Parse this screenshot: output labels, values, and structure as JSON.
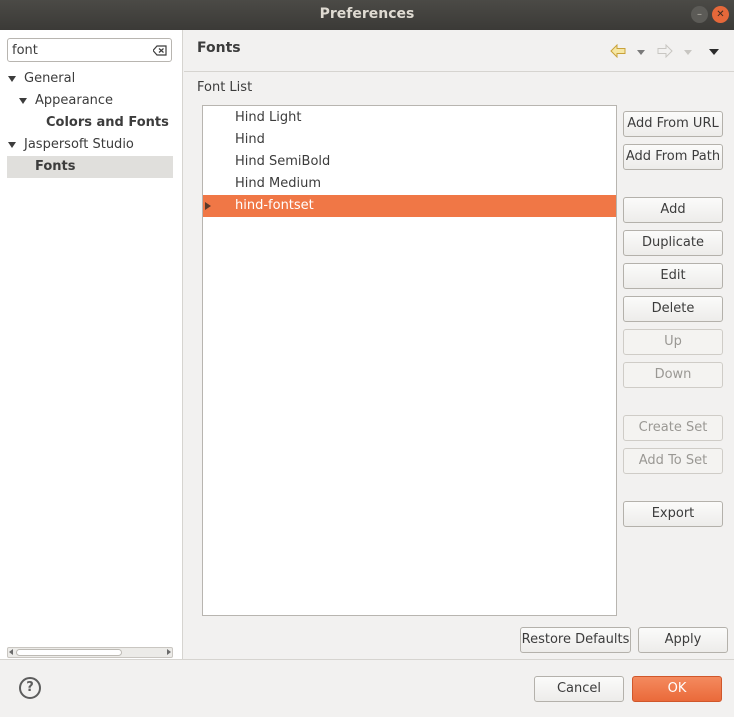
{
  "window": {
    "title": "Preferences"
  },
  "sidebar": {
    "search_value": "font",
    "tree": [
      {
        "label": "General"
      },
      {
        "label": "Appearance"
      },
      {
        "label": "Colors and Fonts"
      },
      {
        "label": "Jaspersoft Studio"
      },
      {
        "label": "Fonts"
      }
    ]
  },
  "page": {
    "title": "Fonts",
    "section_label": "Font List",
    "fonts": [
      {
        "label": "Hind Light"
      },
      {
        "label": "Hind"
      },
      {
        "label": "Hind SemiBold"
      },
      {
        "label": "Hind Medium"
      },
      {
        "label": "hind-fontset"
      }
    ],
    "buttons": {
      "add_from_url": "Add From URL",
      "add_from_path": "Add From Path",
      "add": "Add",
      "duplicate": "Duplicate",
      "edit": "Edit",
      "delete": "Delete",
      "up": "Up",
      "down": "Down",
      "create_set": "Create Set",
      "add_to_set": "Add To Set",
      "export": "Export"
    },
    "restore_defaults": "Restore Defaults",
    "apply": "Apply"
  },
  "footer": {
    "help_glyph": "?",
    "cancel": "Cancel",
    "ok": "OK"
  },
  "colors": {
    "accent": "#f07746",
    "titlebar": "#3b3a37"
  }
}
